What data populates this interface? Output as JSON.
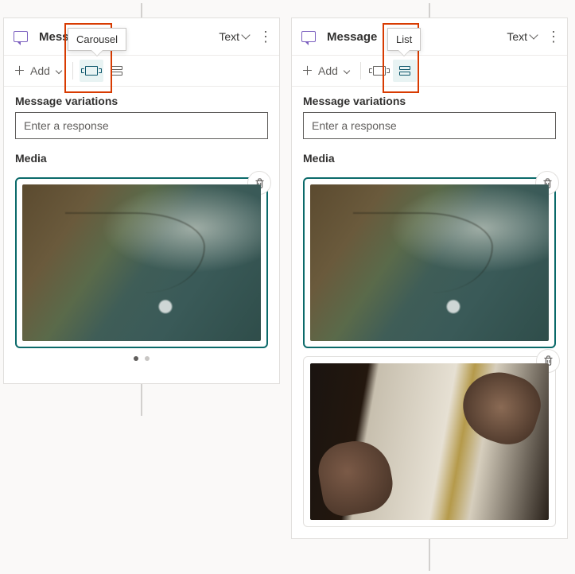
{
  "left": {
    "title": "Message",
    "tooltip": "Carousel",
    "text_menu": "Text",
    "add_label": "Add",
    "section_variations": "Message variations",
    "response_placeholder": "Enter a response",
    "section_media": "Media"
  },
  "right": {
    "title": "Message",
    "tooltip": "List",
    "text_menu": "Text",
    "add_label": "Add",
    "section_variations": "Message variations",
    "response_placeholder": "Enter a response",
    "section_media": "Media"
  }
}
